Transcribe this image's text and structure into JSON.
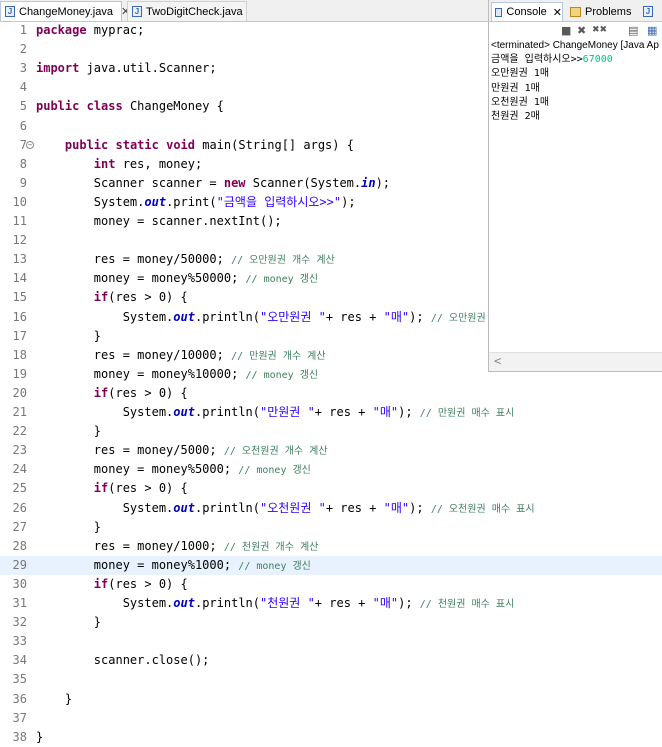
{
  "editor": {
    "tabs": [
      {
        "label": "ChangeMoney.java",
        "close": "✕"
      },
      {
        "label": "TwoDigitCheck.java"
      }
    ]
  },
  "code": {
    "lines": [
      {
        "num": "1",
        "html": "<span class=\"kw\">package</span> myprac;"
      },
      {
        "num": "2",
        "html": ""
      },
      {
        "num": "3",
        "html": "<span class=\"kw\">import</span> java.util.Scanner;"
      },
      {
        "num": "4",
        "html": ""
      },
      {
        "num": "5",
        "html": "<span class=\"kw\">public</span> <span class=\"kw\">class</span> ChangeMoney {"
      },
      {
        "num": "6",
        "html": ""
      },
      {
        "num": "7",
        "fold": true,
        "html": "    <span class=\"kw\">public</span> <span class=\"kw\">static</span> <span class=\"kw\">void</span> main(String[] args) {"
      },
      {
        "num": "8",
        "html": "        <span class=\"kw\">int</span> res, money;"
      },
      {
        "num": "9",
        "html": "        Scanner scanner = <span class=\"kw\">new</span> Scanner(System.<span class=\"fld\">in</span>);"
      },
      {
        "num": "10",
        "html": "        System.<span class=\"fld\">out</span>.print(<span class=\"str\">\"금액을 입력하시오>>\"</span>);"
      },
      {
        "num": "11",
        "html": "        money = scanner.nextInt();"
      },
      {
        "num": "12",
        "html": ""
      },
      {
        "num": "13",
        "html": "        res = money/50000; <span class=\"cm\">// 오만원권 개수 계산</span>"
      },
      {
        "num": "14",
        "html": "        money = money%50000; <span class=\"cm\">// money 갱신</span>"
      },
      {
        "num": "15",
        "html": "        <span class=\"kw\">if</span>(res > 0) {"
      },
      {
        "num": "16",
        "html": "            System.<span class=\"fld\">out</span>.println(<span class=\"str\">\"오만원권 \"</span>+ res + <span class=\"str\">\"매\"</span>); <span class=\"cm\">// 오만원권 매수</span>"
      },
      {
        "num": "17",
        "html": "        }"
      },
      {
        "num": "18",
        "html": "        res = money/10000; <span class=\"cm\">// 만원권 개수 계산</span>"
      },
      {
        "num": "19",
        "html": "        money = money%10000; <span class=\"cm\">// money 갱신</span>"
      },
      {
        "num": "20",
        "html": "        <span class=\"kw\">if</span>(res > 0) {"
      },
      {
        "num": "21",
        "html": "            System.<span class=\"fld\">out</span>.println(<span class=\"str\">\"만원권 \"</span>+ res + <span class=\"str\">\"매\"</span>); <span class=\"cm\">// 만원권 매수 표시</span>"
      },
      {
        "num": "22",
        "html": "        }"
      },
      {
        "num": "23",
        "html": "        res = money/5000; <span class=\"cm\">// 오천원권 개수 계산</span>"
      },
      {
        "num": "24",
        "html": "        money = money%5000; <span class=\"cm\">// money 갱신</span>"
      },
      {
        "num": "25",
        "html": "        <span class=\"kw\">if</span>(res > 0) {"
      },
      {
        "num": "26",
        "html": "            System.<span class=\"fld\">out</span>.println(<span class=\"str\">\"오천원권 \"</span>+ res + <span class=\"str\">\"매\"</span>); <span class=\"cm\">// 오천원권 매수 표시</span>"
      },
      {
        "num": "27",
        "html": "        }"
      },
      {
        "num": "28",
        "html": "        res = money/1000; <span class=\"cm\">// 천원권 개수 계산</span>"
      },
      {
        "num": "29",
        "current": true,
        "html": "        money = money%1000; <span class=\"cm\">// money 갱신</span>"
      },
      {
        "num": "30",
        "html": "        <span class=\"kw\">if</span>(res > 0) {"
      },
      {
        "num": "31",
        "html": "            System.<span class=\"fld\">out</span>.println(<span class=\"str\">\"천원권 \"</span>+ res + <span class=\"str\">\"매\"</span>); <span class=\"cm\">// 천원권 매수 표시</span>"
      },
      {
        "num": "32",
        "html": "        }"
      },
      {
        "num": "33",
        "html": ""
      },
      {
        "num": "34",
        "html": "        scanner.close();"
      },
      {
        "num": "35",
        "html": ""
      },
      {
        "num": "36",
        "html": "    }"
      },
      {
        "num": "37",
        "html": ""
      },
      {
        "num": "38",
        "html": "}"
      }
    ]
  },
  "console": {
    "tabs": {
      "console_label": "Console",
      "console_close": "✕",
      "problems_label": "Problems"
    },
    "terminated": "<terminated> ChangeMoney [Java Ap",
    "prompt": "금액을 입력하시오>>",
    "input_value": "67000",
    "output": [
      "오만원권 1매",
      "만원권 1매",
      "오천원권 1매",
      "천원권 2매"
    ],
    "toolbar": [
      {
        "icon": "terminate-icon",
        "glyph": "■"
      },
      {
        "icon": "remove-launch-icon",
        "glyph": "✖"
      },
      {
        "icon": "remove-all-icon",
        "glyph": "✖✖"
      },
      {
        "icon": "copy-icon",
        "glyph": "▤"
      },
      {
        "icon": "scroll-lock-icon",
        "glyph": "▦"
      }
    ],
    "scroll_left": "<"
  }
}
